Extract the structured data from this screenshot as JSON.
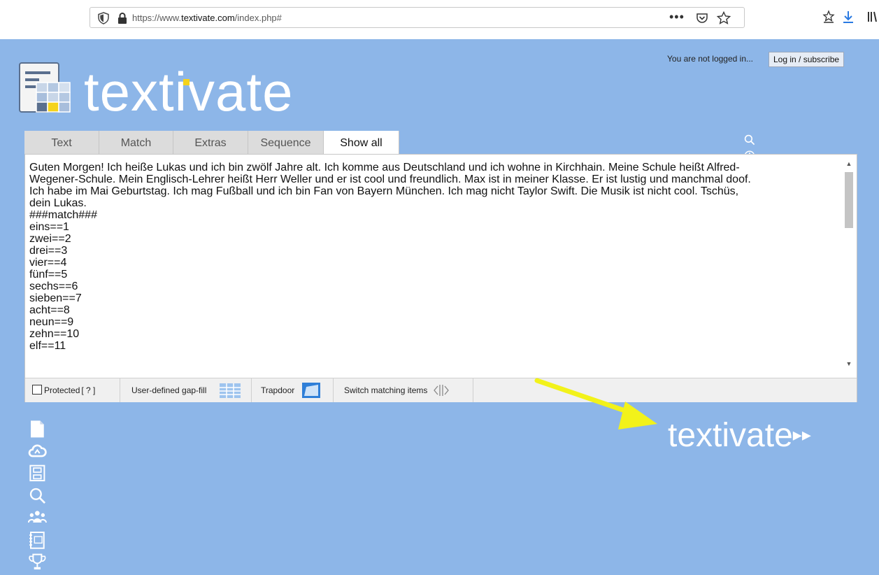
{
  "browser": {
    "url_prefix": "https://www.",
    "url_domain": "textivate.com",
    "url_path": "/index.php#",
    "more_label": "•••"
  },
  "account": {
    "status": "You are not logged in...",
    "login_label": "Log in / subscribe"
  },
  "logo": {
    "text": "textivate",
    "accent": "#f5d31c"
  },
  "tabs": [
    {
      "label": "Text"
    },
    {
      "label": "Match"
    },
    {
      "label": "Extras"
    },
    {
      "label": "Sequence"
    },
    {
      "label": "Show all"
    }
  ],
  "toolbar_icons": [
    "search-icon",
    "palette-icon",
    "award-icon",
    "add-info-icon",
    "share-icon"
  ],
  "editor": {
    "content": "Guten Morgen! Ich heiße Lukas und ich bin zwölf Jahre alt. Ich komme aus Deutschland und ich wohne in Kirchhain. Meine Schule heißt Alfred-\nWegener-Schule. Mein Englisch-Lehrer heißt Herr Weller und er ist cool und freundlich. Max ist in meiner Klasse. Er ist lustig und manchmal doof.\nIch habe im Mai Geburtstag. Ich mag Fußball und ich bin Fan von Bayern München. Ich mag nicht Taylor Swift. Die Musik ist nicht cool. Tschüs,\ndein Lukas.\n###match###\neins==1\nzwei==2\ndrei==3\nvier==4\nfünf==5\nsechs==6\nsieben==7\nacht==8\nneun==9\nzehn==10\nelf==11"
  },
  "options": {
    "protected_label": "Protected",
    "help_label": "[ ? ]",
    "gapfill_label": "User-defined gap-fill",
    "trapdoor_label": "Trapdoor",
    "switch_label": "Switch matching items"
  },
  "brand": {
    "text": "textivate",
    "suffix": "▸▸"
  },
  "colors": {
    "background": "#8db6e8",
    "arrow": "#f2f21a"
  }
}
